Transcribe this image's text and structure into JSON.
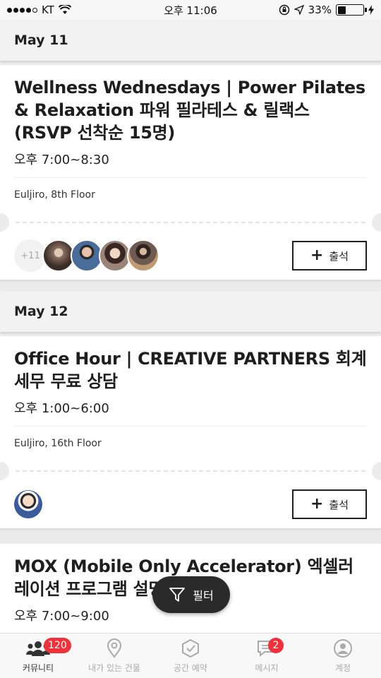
{
  "status_bar": {
    "carrier": "KT",
    "time": "오후 11:06",
    "battery": "33%",
    "battery_level": 0.33
  },
  "events": [
    {
      "date": "May 11",
      "title": "Wellness Wednesdays | Power Pilates & Relaxation 파워 필라테스 & 릴랙스 (RSVP 선착순 15명)",
      "time": "오후 7:00~8:30",
      "location": "Euljiro, 8th Floor",
      "more_attendees": "+11",
      "checkin_label": "출석"
    },
    {
      "date": "May 12",
      "title": "Office Hour | CREATIVE PARTNERS 회계 세무 무료 상담",
      "time": "오후 1:00~6:00",
      "location": "Euljiro, 16th Floor",
      "checkin_label": "출석"
    },
    {
      "title": "MOX (Mobile Only Accelerator) 엑셀러레이션 프로그램 설명회",
      "time": "오후 7:00~9:00"
    }
  ],
  "filter_button": {
    "label": "필터",
    "icon": "filter-icon"
  },
  "tab_bar": {
    "tabs": [
      {
        "label": "커뮤니티",
        "icon": "people-icon",
        "badge": "120",
        "active": true
      },
      {
        "label": "내가 있는 건물",
        "icon": "location-pin-icon",
        "badge": "",
        "active": false
      },
      {
        "label": "공간 예약",
        "icon": "booking-icon",
        "badge": "",
        "active": false
      },
      {
        "label": "메시지",
        "icon": "message-icon",
        "badge": "2",
        "active": false
      },
      {
        "label": "계정",
        "icon": "account-icon",
        "badge": "",
        "active": false
      }
    ]
  },
  "colors": {
    "badge": "#f0303a",
    "fab_background": "#2a2a2a",
    "page_background": "#ececec"
  }
}
